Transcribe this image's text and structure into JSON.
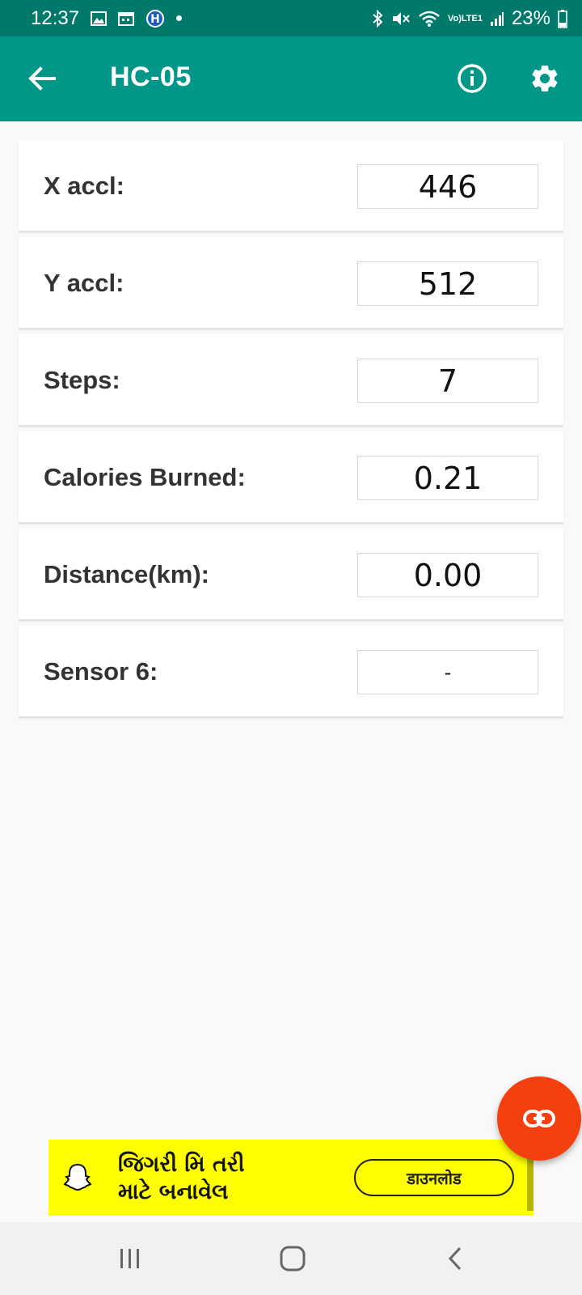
{
  "status_bar": {
    "time": "12:37",
    "battery_percent": "23%",
    "network_label_top": "Vo)",
    "network_label_bottom": "LTE1",
    "icons": [
      "image-icon",
      "calendar-icon",
      "h-app-icon",
      "dot-icon",
      "bluetooth-icon",
      "mute-icon",
      "wifi-icon",
      "signal-icon",
      "battery-icon"
    ]
  },
  "app_bar": {
    "title": "HC-05",
    "icons": [
      "back-arrow-icon",
      "info-icon",
      "settings-gear-icon"
    ]
  },
  "sensors": [
    {
      "label": "X accl:",
      "value": "446"
    },
    {
      "label": "Y accl:",
      "value": "512"
    },
    {
      "label": "Steps:",
      "value": "7"
    },
    {
      "label": "Calories Burned:",
      "value": "0.21"
    },
    {
      "label": "Distance(km):",
      "value": "0.00"
    },
    {
      "label": "Sensor 6:",
      "value": "-"
    }
  ],
  "fab": {
    "icon": "link-icon",
    "color": "#f4400e"
  },
  "ad": {
    "line1": "જિગરી મિ તરી",
    "line2": "માટે બનાવેલ",
    "button_label": "डाउनलोड",
    "icon": "snapchat-ghost-icon",
    "background": "#ffff00"
  },
  "nav_bar": {
    "icons": [
      "recents-icon",
      "home-icon",
      "back-icon"
    ]
  },
  "colors": {
    "status_bar": "#00796b",
    "app_bar": "#009688",
    "background": "#f9f9f9"
  }
}
